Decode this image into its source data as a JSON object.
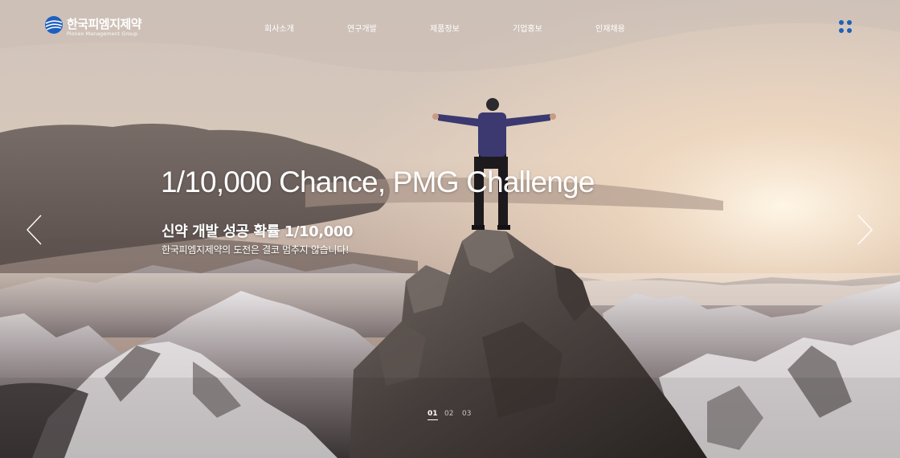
{
  "header": {
    "logo_name": "한국피엠지제약",
    "logo_sub": "Pionex Management Group",
    "nav": [
      {
        "label": "회사소개"
      },
      {
        "label": "연구개발"
      },
      {
        "label": "제품정보"
      },
      {
        "label": "기업홍보"
      },
      {
        "label": "인재채용"
      }
    ],
    "menu_icon": "grid-dots-icon",
    "menu_color": "#1f5fb8"
  },
  "hero": {
    "headline": "1/10,000 Chance, PMG Challenge",
    "subhead": "신약 개발 성공 확률 1/10,000",
    "description": "한국피엠지제약의 도전은 결코 멈추지 않습니다!",
    "prev_icon": "chevron-left-icon",
    "next_icon": "chevron-right-icon"
  },
  "pager": {
    "slides": [
      "01",
      "02",
      "03"
    ],
    "active": "01"
  }
}
